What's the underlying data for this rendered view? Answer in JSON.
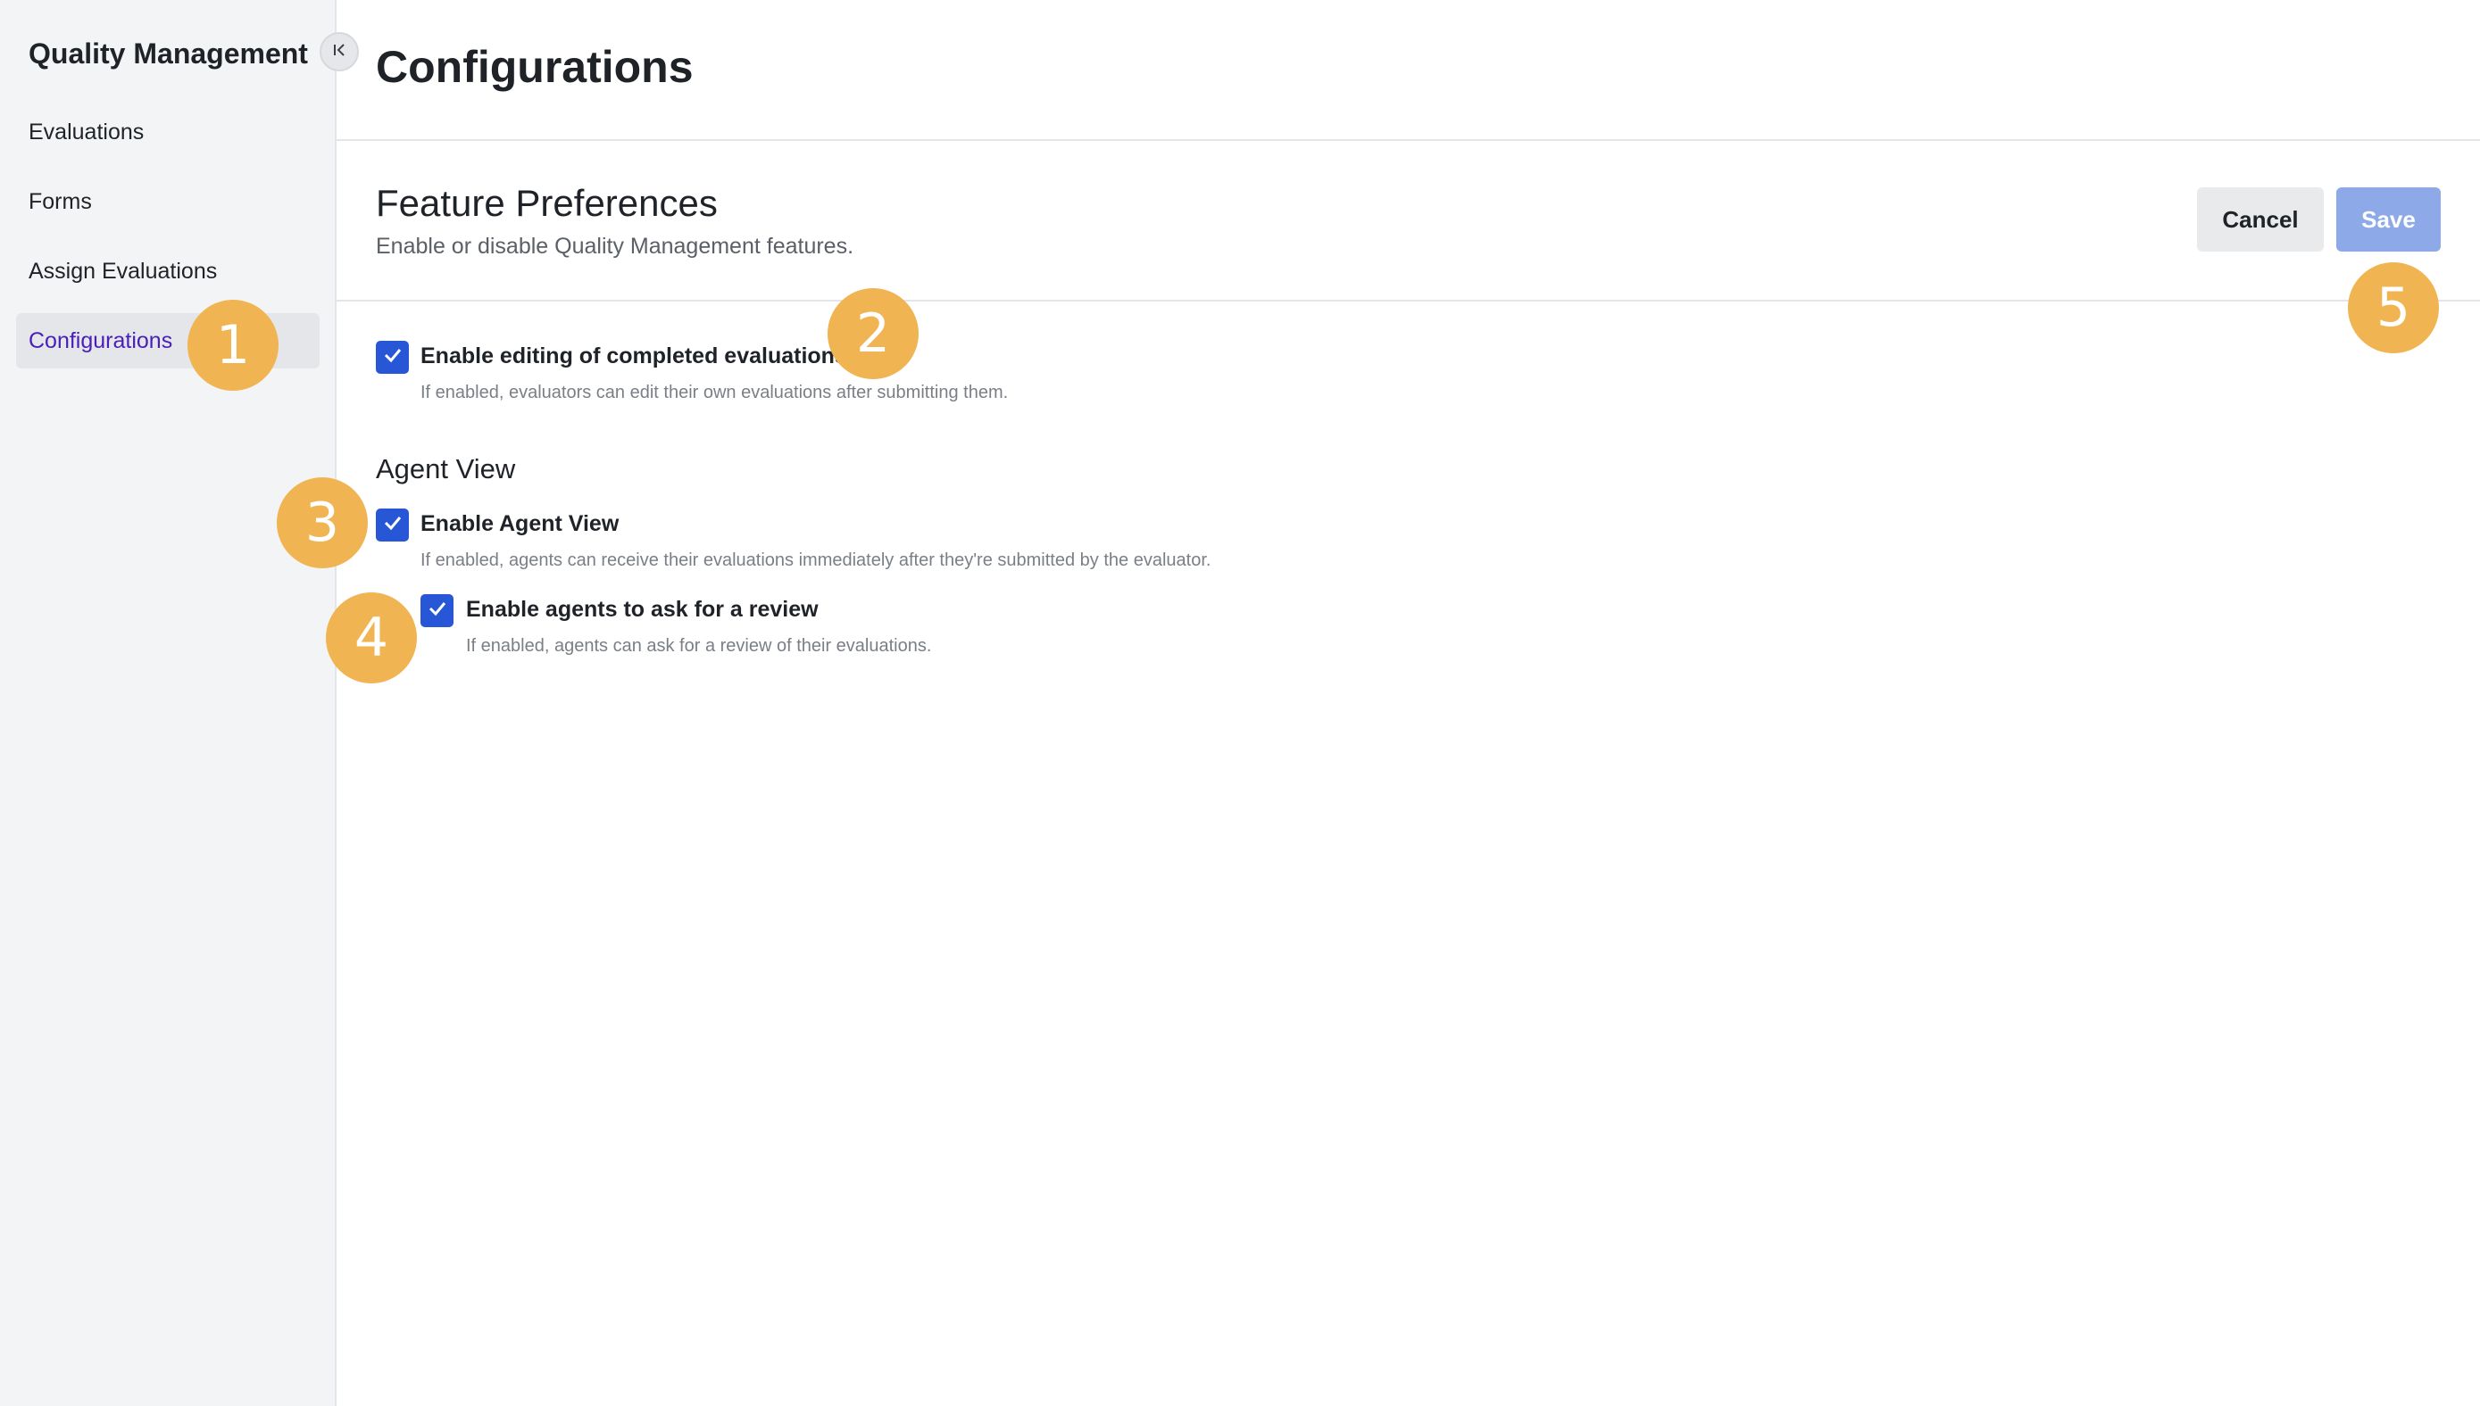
{
  "sidebar": {
    "title": "Quality Management",
    "collapse_icon": "collapse-left-icon",
    "items": [
      {
        "label": "Evaluations",
        "active": false
      },
      {
        "label": "Forms",
        "active": false
      },
      {
        "label": "Assign Evaluations",
        "active": false
      },
      {
        "label": "Configurations",
        "active": true
      }
    ]
  },
  "page": {
    "title": "Configurations"
  },
  "section": {
    "title": "Feature Preferences",
    "subtitle": "Enable or disable Quality Management features.",
    "cancel_label": "Cancel",
    "save_label": "Save"
  },
  "options": {
    "edit_completed": {
      "label": "Enable editing of completed evaluations",
      "description": "If enabled, evaluators can edit their own evaluations after submitting them.",
      "checked": true
    },
    "agent_view_group": "Agent View",
    "agent_view": {
      "label": "Enable Agent View",
      "description": "If enabled, agents can receive their evaluations immediately after they're submitted by the evaluator.",
      "checked": true
    },
    "ask_review": {
      "label": "Enable agents to ask for a review",
      "description": "If enabled, agents can ask for a review of their evaluations.",
      "checked": true
    }
  },
  "callouts": [
    "1",
    "2",
    "3",
    "4",
    "5"
  ],
  "colors": {
    "accent": "#2757d6",
    "active_nav_text": "#4a1fb8",
    "save_disabled": "#8ea9e8",
    "callout": "#f0b452"
  }
}
